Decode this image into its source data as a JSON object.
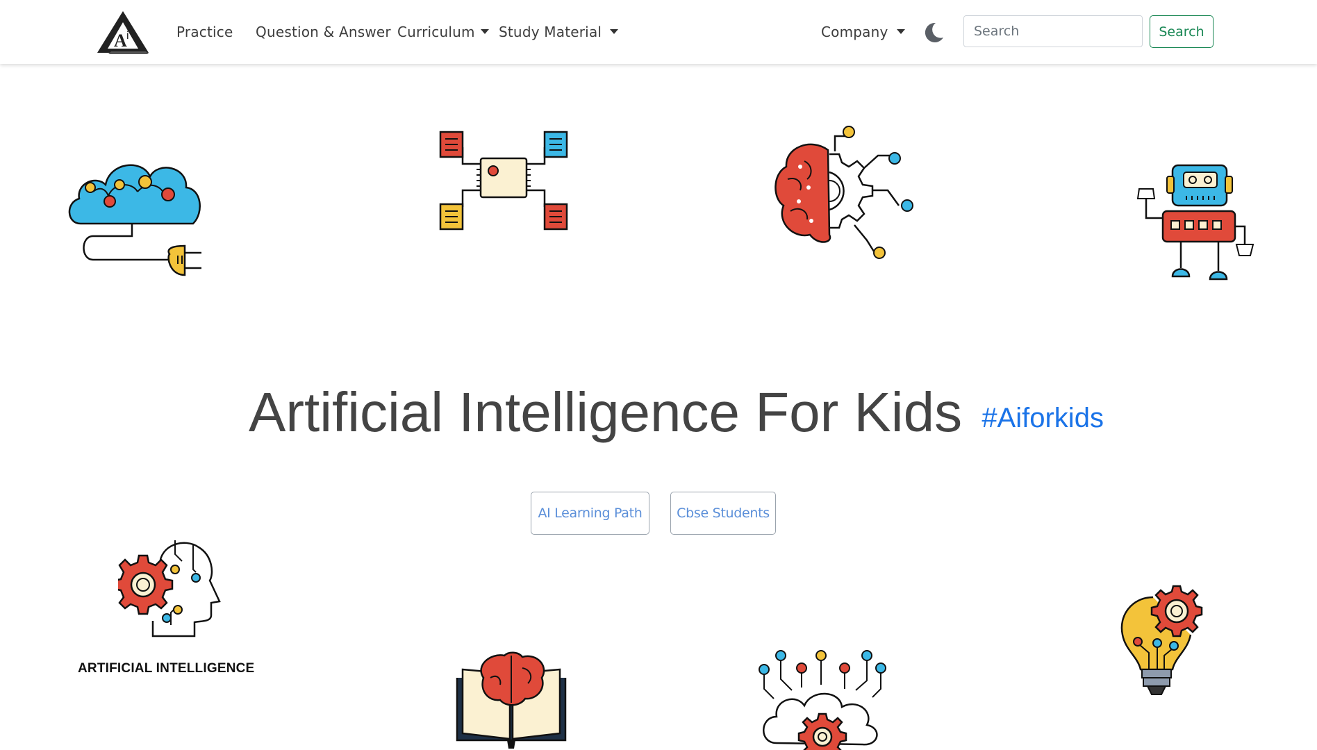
{
  "nav": {
    "links": [
      "Practice",
      "Question & Answer",
      "Curriculum",
      "Study Material"
    ],
    "company": "Company",
    "search_placeholder": "Search",
    "search_button": "Search"
  },
  "hero": {
    "title": "Artificial Intelligence For Kids",
    "hashtag": "#Aiforkids",
    "buttons": [
      "AI Learning Path",
      "Cbse Students"
    ]
  },
  "illustrations": {
    "caption": "ARTIFICIAL INTELLIGENCE"
  },
  "colors": {
    "accent_green": "#198754",
    "hashtag_blue": "#1a73e8",
    "button_text": "#5b8fd9",
    "illus_red": "#e04a3a",
    "illus_blue": "#3cb8e6",
    "illus_yellow": "#f3c33a"
  }
}
